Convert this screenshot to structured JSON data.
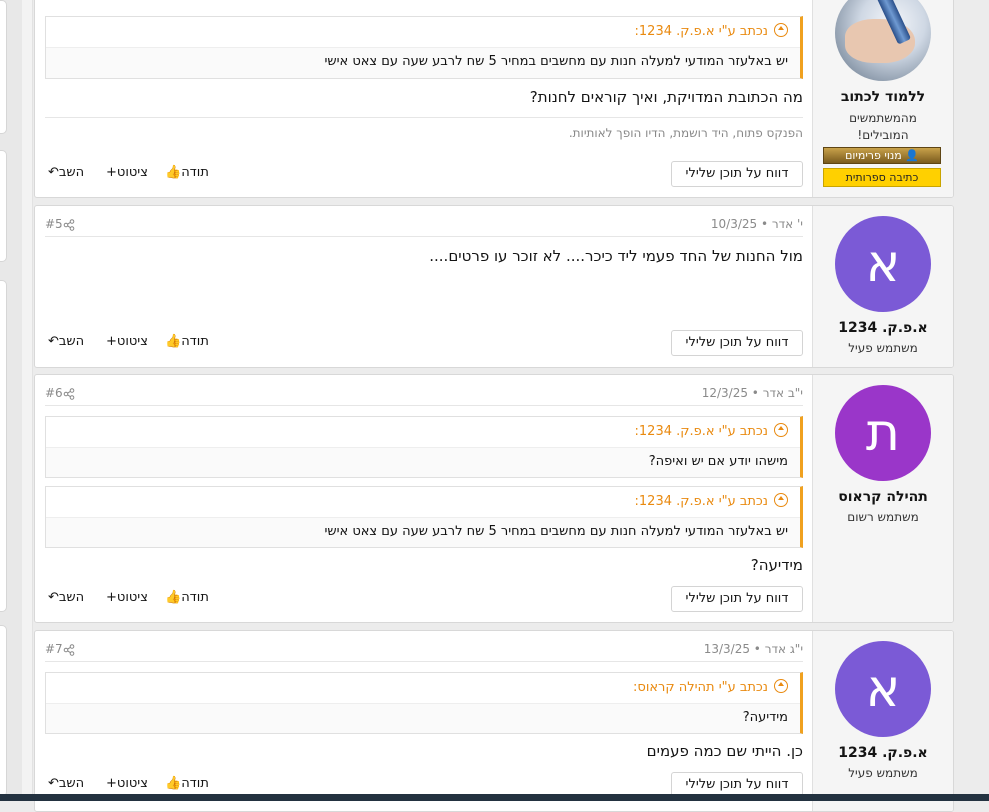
{
  "actions": {
    "report": "דווח על תוכן שלילי",
    "thanks": "תודה",
    "quote": "ציטוט",
    "reply": "השב"
  },
  "posts": [
    {
      "user": {
        "name": "ללמוד לכתוב",
        "title_line1": "מהמשתמשים",
        "title_line2": "המובילים!",
        "badge_premium": "מנוי פרימיום",
        "badge_literary": "כתיבה ספרותית"
      },
      "quote": {
        "header": "נכתב ע\"י א.פ.ק. 1234:",
        "text": "יש באלעזר המודעי למעלה חנות עם מחשבים במחיר 5 שח לרבע שעה עם צאט אישי"
      },
      "body": "מה הכתובת המדויקת, ואיך קוראים לחנות?",
      "signature": "הפנקס פתוח, היד רושמת, הדיו הופך לאותיות."
    },
    {
      "meta": {
        "date": "י' אדר • 10/3/25",
        "num": "#5"
      },
      "user": {
        "initial": "א",
        "name": "א.פ.ק. 1234",
        "title": "משתמש פעיל"
      },
      "body": "מול החנות של החד פעמי ליד כיכר.... לא זוכר עו פרטים...."
    },
    {
      "meta": {
        "date": "י\"ב אדר • 12/3/25",
        "num": "#6"
      },
      "user": {
        "initial": "ת",
        "name": "תהילה קראוס",
        "title": "משתמש רשום"
      },
      "quote1": {
        "header": "נכתב ע\"י א.פ.ק. 1234:",
        "text": "מישהו יודע אם יש ואיפה?"
      },
      "quote2": {
        "header": "נכתב ע\"י א.פ.ק. 1234:",
        "text": "יש באלעזר המודעי למעלה חנות עם מחשבים במחיר 5 שח לרבע שעה עם צאט אישי"
      },
      "body": "מידיעה?"
    },
    {
      "meta": {
        "date": "י\"ג אדר • 13/3/25",
        "num": "#7"
      },
      "user": {
        "initial": "א",
        "name": "א.פ.ק. 1234",
        "title": "משתמש פעיל"
      },
      "quote": {
        "header": "נכתב ע\"י תהילה קראוס:",
        "text": "מידיעה?"
      },
      "body": "כן. הייתי שם כמה פעמים"
    }
  ],
  "colors": {
    "accent": "#f0a11f",
    "avatar_alef": "#7b5ad6",
    "avatar_tav": "#9a36c9"
  }
}
